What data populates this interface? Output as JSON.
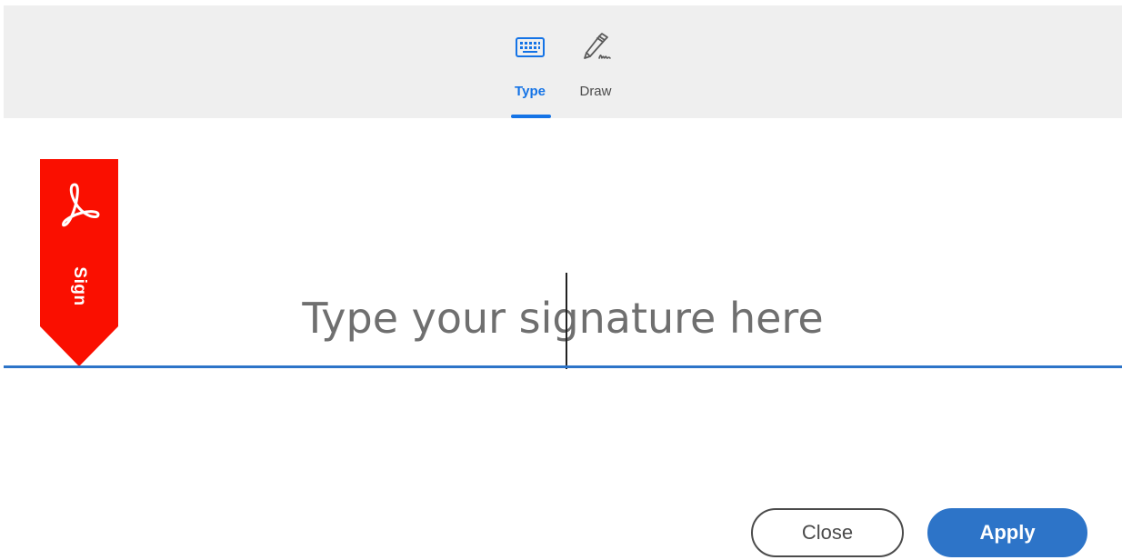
{
  "tabs": [
    {
      "label": "Type",
      "icon": "keyboard-icon",
      "selected": true
    },
    {
      "label": "Draw",
      "icon": "pen-draw-icon",
      "selected": false
    }
  ],
  "sign_flag": {
    "label": "Sign",
    "icon": "adobe-acrobat-icon",
    "color": "#fa0f00"
  },
  "signature": {
    "placeholder": "Type your signature here",
    "value": ""
  },
  "buttons": {
    "close_label": "Close",
    "apply_label": "Apply"
  },
  "colors": {
    "accent": "#1473e6",
    "primary_button": "#2d74c8",
    "tabbar_bg": "#efefef"
  }
}
